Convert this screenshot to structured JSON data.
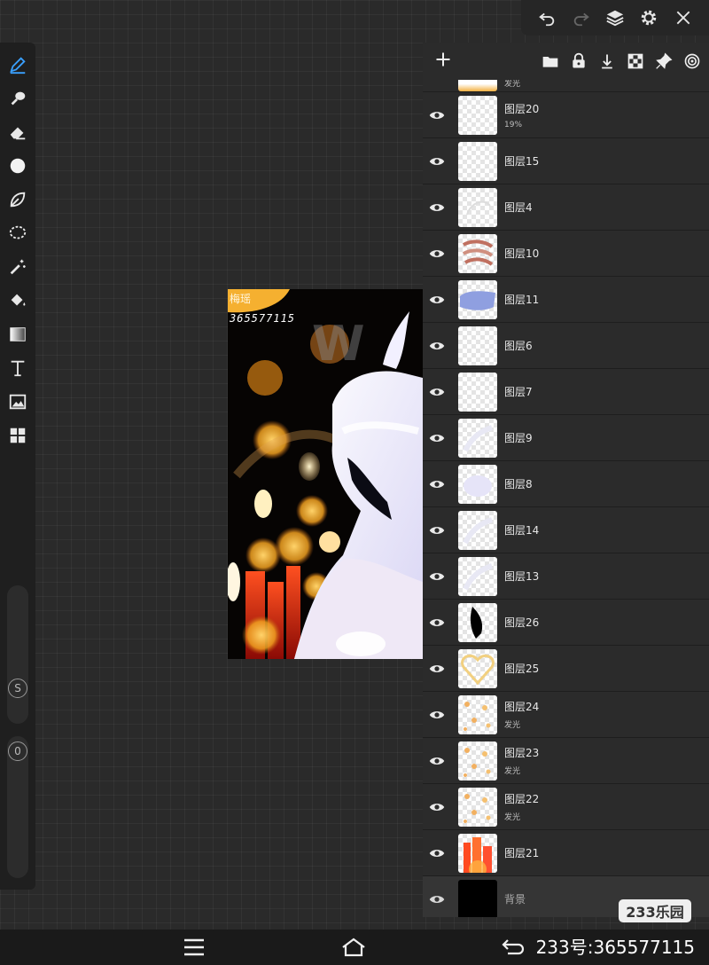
{
  "top_bar": {
    "icons": [
      "undo-icon",
      "redo-icon",
      "layers-icon",
      "settings-icon",
      "close-icon"
    ]
  },
  "left_toolbar": {
    "tools": [
      "pen-tool-icon",
      "smudge-tool-icon",
      "eraser-tool-icon",
      "brush-size-dot-icon",
      "leaf-shape-icon",
      "lasso-select-icon",
      "magic-wand-icon",
      "fill-bucket-icon",
      "gradient-icon",
      "text-tool-icon",
      "image-import-icon",
      "grid-panels-icon"
    ],
    "size_slider_label": "S",
    "opacity_slider_label": "0"
  },
  "artwork": {
    "top_text": "梅瑶",
    "id_text": "365577115"
  },
  "layers_toolbar": {
    "icons": [
      "add-layer-icon",
      "folder-icon",
      "lock-icon",
      "merge-down-icon",
      "checkerboard-icon",
      "pin-icon",
      "target-icon"
    ]
  },
  "layers": {
    "partial_top": {
      "sub": "发光"
    },
    "items": [
      {
        "name": "图层20",
        "sub": "19%"
      },
      {
        "name": "图层15",
        "sub": ""
      },
      {
        "name": "图层4",
        "sub": ""
      },
      {
        "name": "图层10",
        "sub": ""
      },
      {
        "name": "图层11",
        "sub": ""
      },
      {
        "name": "图层6",
        "sub": ""
      },
      {
        "name": "图层7",
        "sub": ""
      },
      {
        "name": "图层9",
        "sub": ""
      },
      {
        "name": "图层8",
        "sub": ""
      },
      {
        "name": "图层14",
        "sub": ""
      },
      {
        "name": "图层13",
        "sub": ""
      },
      {
        "name": "图层26",
        "sub": ""
      },
      {
        "name": "图层25",
        "sub": ""
      },
      {
        "name": "图层24",
        "sub": "发光"
      },
      {
        "name": "图层23",
        "sub": "发光"
      },
      {
        "name": "图层22",
        "sub": "发光"
      },
      {
        "name": "图层21",
        "sub": ""
      }
    ],
    "background": {
      "name": "背景"
    }
  },
  "watermark": {
    "logo_text": "233乐园",
    "id_text": "233号:365577115"
  },
  "nav_bar": {
    "icons": [
      "menu-icon",
      "home-icon",
      "back-icon"
    ]
  }
}
